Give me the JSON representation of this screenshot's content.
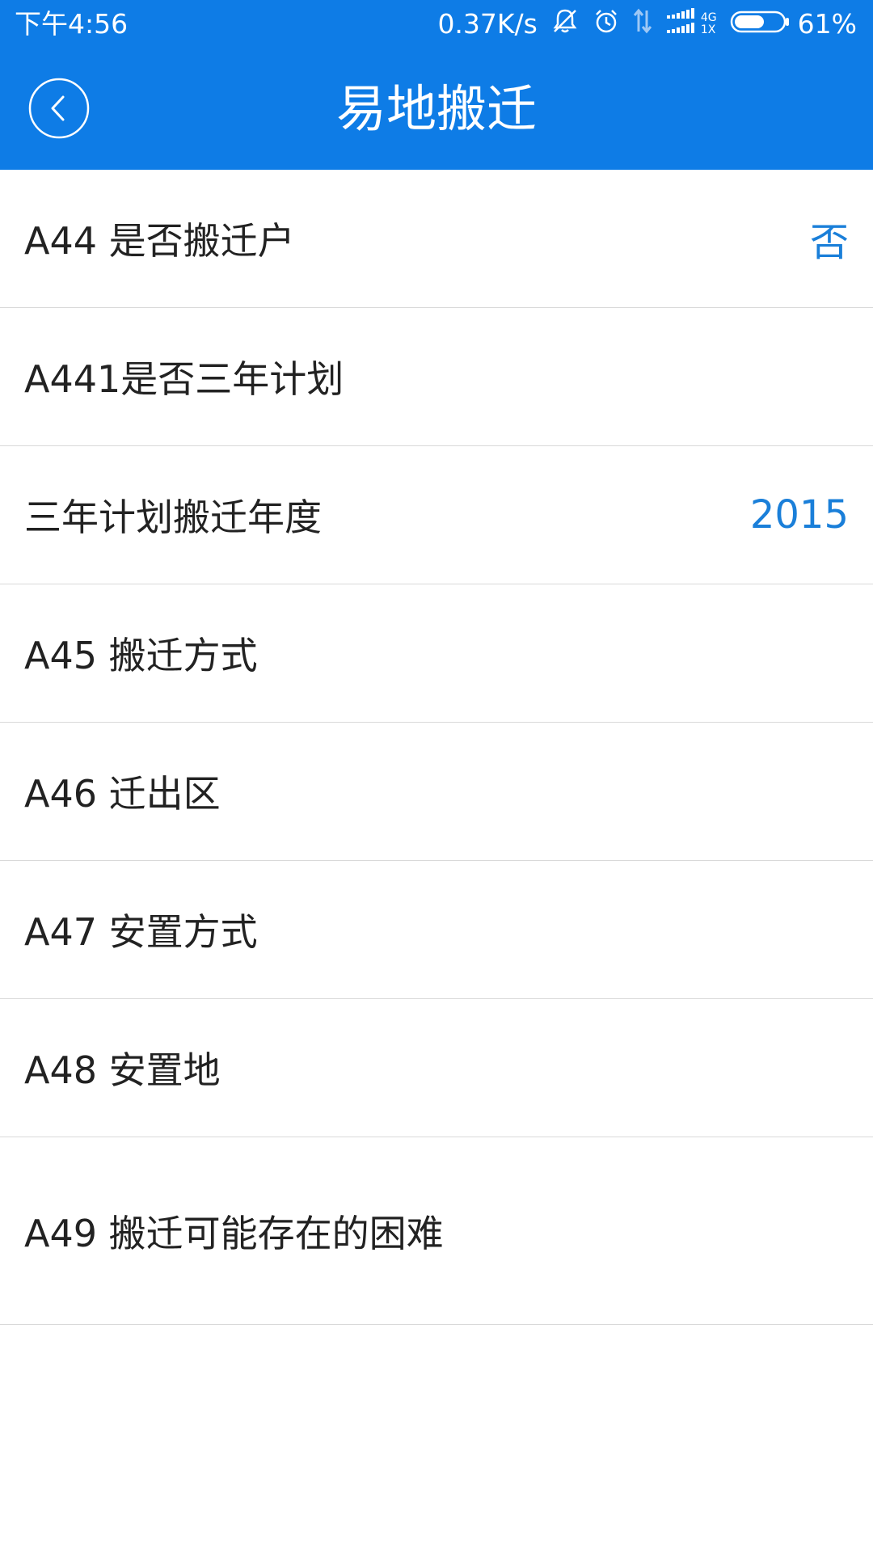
{
  "status_bar": {
    "time": "下午4:56",
    "net_speed": "0.37K/s",
    "net_type_top": "4G",
    "net_type_bottom": "1X",
    "battery": "61%",
    "icons": [
      "mute-icon",
      "alarm-icon",
      "data-transfer-icon",
      "signal-icon",
      "battery-icon"
    ]
  },
  "header": {
    "title": "易地搬迁",
    "back_icon": "chevron-left-icon",
    "color": "#0e7ce6"
  },
  "rows": [
    {
      "label": "A44 是否搬迁户",
      "value": "否"
    },
    {
      "label": "A441是否三年计划",
      "value": ""
    },
    {
      "label": "三年计划搬迁年度",
      "value": "2015"
    },
    {
      "label": "A45 搬迁方式",
      "value": ""
    },
    {
      "label": "A46 迁出区",
      "value": ""
    },
    {
      "label": "A47 安置方式",
      "value": ""
    },
    {
      "label": "A48 安置地",
      "value": ""
    },
    {
      "label": "A49 搬迁可能存在的困难",
      "value": ""
    }
  ],
  "colors": {
    "accent": "#0e7ce6",
    "value_text": "#1a7fd9",
    "label_text": "#222222",
    "divider": "#d9d9d9"
  }
}
